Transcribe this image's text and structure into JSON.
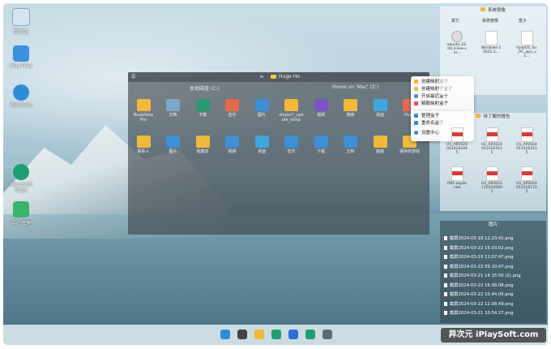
{
  "desktop": {
    "icons": [
      {
        "label": "回收站",
        "icon": "recycle-bin-icon",
        "color": "#7fa7c8"
      },
      {
        "label": "Mac Files",
        "icon": "finder-icon",
        "color": "#3d8fe0"
      },
      {
        "label": "Windows",
        "icon": "windows-logo-icon",
        "color": "#2d8cd6"
      },
      {
        "label": "Microsoft Edge",
        "icon": "edge-icon",
        "color": "#1f9e74"
      },
      {
        "label": "中心管理",
        "icon": "app-grid-icon",
        "color": "#3ab36b"
      }
    ]
  },
  "main_fence": {
    "title": "Hugo Ho",
    "left_section": "本地磁盘 (C:)",
    "right_section": "Home on 'Mac' (Z:)",
    "row1": [
      {
        "label": "BookNote\nPro",
        "icon": "folder-icon",
        "color": "#f0b93a"
      },
      {
        "label": "文档",
        "icon": "documents-folder-icon",
        "color": "#7da7c6"
      },
      {
        "label": "下载",
        "icon": "downloads-folder-icon",
        "color": "#2a9a6e"
      },
      {
        "label": "音乐",
        "icon": "music-folder-icon",
        "color": "#e46a4e"
      },
      {
        "label": "图片",
        "icon": "pictures-folder-icon",
        "color": "#3f8fd6"
      },
      {
        "label": "shipin7_upd\nate_temp",
        "icon": "folder-icon",
        "color": "#f0b93a"
      },
      {
        "label": "视频",
        "icon": "videos-folder-icon",
        "color": "#7c53c7"
      },
      {
        "label": "搜索",
        "icon": "search-folder-icon",
        "color": "#f0b93a"
      },
      {
        "label": "桌面",
        "icon": "desktop-folder-icon",
        "color": "#3fa7e0"
      },
      {
        "label": "Hugo",
        "icon": "user-folder-icon",
        "color": "#e46a4e"
      }
    ],
    "row2": [
      {
        "label": "联系人",
        "icon": "contacts-folder-icon",
        "color": "#f0b93a"
      },
      {
        "label": "图片",
        "icon": "pictures-folder-icon",
        "color": "#3f8fd6"
      },
      {
        "label": "收藏夹",
        "icon": "favorites-folder-icon",
        "color": "#f0b93a"
      },
      {
        "label": "视频",
        "icon": "videos-folder-icon",
        "color": "#3f8fd6"
      },
      {
        "label": "桌面",
        "icon": "desktop-folder-icon",
        "color": "#3fa7e0"
      },
      {
        "label": "音乐",
        "icon": "music-folder-icon",
        "color": "#3f8fd6"
      },
      {
        "label": "下载",
        "icon": "downloads-folder-icon",
        "color": "#3f8fd6"
      },
      {
        "label": "文档",
        "icon": "documents-folder-icon",
        "color": "#3f8fd6"
      },
      {
        "label": "链接",
        "icon": "links-folder-icon",
        "color": "#f0b93a"
      },
      {
        "label": "保存的游戏",
        "icon": "saved-games-folder-icon",
        "color": "#f0b93a"
      }
    ]
  },
  "context_menu": {
    "items": [
      {
        "label": "创建映射盒子",
        "color": "#f0b93a"
      },
      {
        "label": "创建映射子盒子",
        "color": "#f0b93a"
      },
      {
        "label": "开启最近盒子",
        "color": "#2d8cd6"
      },
      {
        "label": "解散映射盒子",
        "color": "#e05353"
      },
      {
        "label": "整理盒子",
        "color": "#2d8cd6"
      },
      {
        "label": "重命名盒子",
        "color": "#2d8cd6"
      },
      {
        "label": "设置中心",
        "color": "#2d8cd6"
      }
    ]
  },
  "system_fence": {
    "title": "系统镜像",
    "headers": [
      "其它",
      "系统镜像",
      "盒子"
    ],
    "items": [
      {
        "label": "ubuntu-22.04.3-live-ser...",
        "type": "disc"
      },
      {
        "label": "Windows-22631.2...",
        "type": "file"
      },
      {
        "label": "FydeOS_for_PC_apu_v1...",
        "type": "file"
      }
    ]
  },
  "pdf_fence": {
    "title": "待了解的报告",
    "items": [
      {
        "label": "H1_AP20240224162445"
      },
      {
        "label": "H1_AP20240131163115"
      },
      {
        "label": "H1_AP20240131163155"
      },
      {
        "label": "PDF explained"
      },
      {
        "label": "H1_AP20231201145601"
      },
      {
        "label": "H1_AP20240131161725"
      }
    ]
  },
  "pictures_fence": {
    "title": "图片",
    "files": [
      "截屏2024-03-18 12.23.41.png",
      "截屏2024-03-22 16.03.02.png",
      "截屏2024-03-19 12.07.47.png",
      "截屏2024-03-22 09.10.47.png",
      "截屏2024-03-21 14.15.50 (2).png",
      "截屏2024-03-22 16.08.08.png",
      "截屏2024-03-22 10.44.06.png",
      "截屏2024-03-22 12.08.49.png",
      "截屏2024-03-21 10.54.27.png"
    ]
  },
  "taskbar": {
    "icons": [
      {
        "icon": "windows-start-icon",
        "color": "#2d8cd6"
      },
      {
        "icon": "search-icon",
        "color": "#444444"
      },
      {
        "icon": "file-explorer-icon",
        "color": "#f0b93a"
      },
      {
        "icon": "edge-icon",
        "color": "#1f9e74"
      },
      {
        "icon": "store-icon",
        "color": "#2d6fd6"
      },
      {
        "icon": "app-icon",
        "color": "#1f9e74"
      },
      {
        "icon": "settings-gear-icon",
        "color": "#5a6b7a"
      }
    ]
  },
  "watermark": "异次元 iPlaySoft.com"
}
